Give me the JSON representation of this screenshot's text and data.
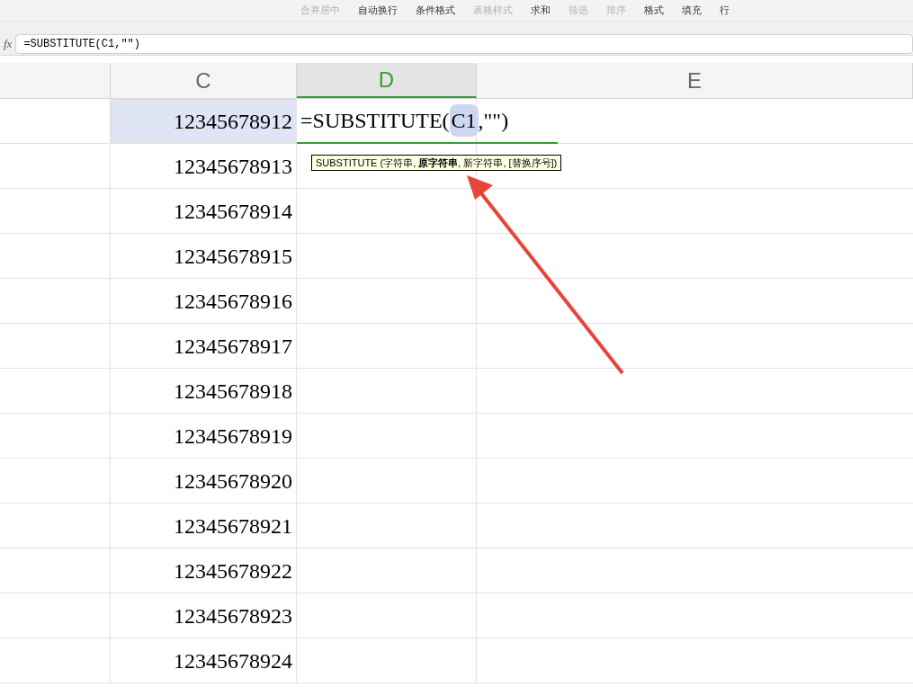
{
  "toolbar": {
    "buttons": [
      {
        "label": "合并居中",
        "disabled": true
      },
      {
        "label": "自动换行",
        "disabled": false
      },
      {
        "label": "条件格式",
        "disabled": false
      },
      {
        "label": "表格样式",
        "disabled": true
      },
      {
        "label": "求和",
        "disabled": false
      },
      {
        "label": "筛选",
        "disabled": true
      },
      {
        "label": "排序",
        "disabled": true
      },
      {
        "label": "格式",
        "disabled": false
      },
      {
        "label": "填充",
        "disabled": false
      },
      {
        "label": "行",
        "disabled": false
      }
    ]
  },
  "formula_bar": {
    "label": "fx",
    "value": "=SUBSTITUTE(C1,\"\")"
  },
  "columns": [
    {
      "selected": false
    },
    {
      "label": "C",
      "selected": false
    },
    {
      "label": "D",
      "selected": true
    },
    {
      "label": "E",
      "selected": false
    }
  ],
  "editing_cell": {
    "before": "=SUBSTITUTE(",
    "reference": "C1",
    "after": ",\"\")"
  },
  "tooltip": "SUBSTITUTE (字符串, **原字符串**, 新字符串, [替换序号])",
  "rows": [
    {
      "c": "12345678912",
      "selected": true
    },
    {
      "c": "12345678913",
      "selected": false
    },
    {
      "c": "12345678914",
      "selected": false
    },
    {
      "c": "12345678915",
      "selected": false
    },
    {
      "c": "12345678916",
      "selected": false
    },
    {
      "c": "12345678917",
      "selected": false
    },
    {
      "c": "12345678918",
      "selected": false
    },
    {
      "c": "12345678919",
      "selected": false
    },
    {
      "c": "12345678920",
      "selected": false
    },
    {
      "c": "12345678921",
      "selected": false
    },
    {
      "c": "12345678922",
      "selected": false
    },
    {
      "c": "12345678923",
      "selected": false
    },
    {
      "c": "12345678924",
      "selected": false
    }
  ]
}
